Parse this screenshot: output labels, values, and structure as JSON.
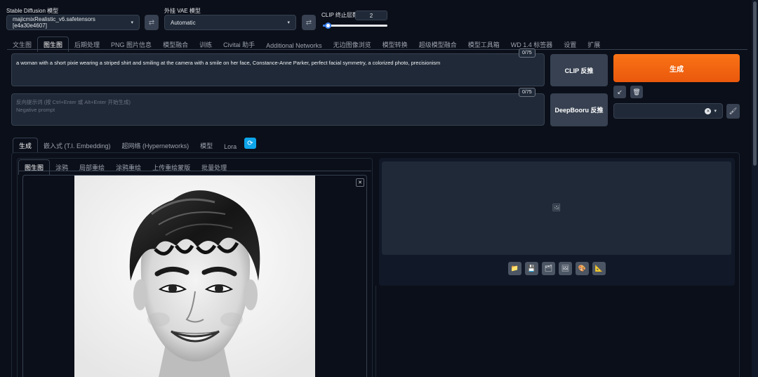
{
  "top": {
    "sd_model_label": "Stable Diffusion 模型",
    "sd_model_value": "majicmixRealistic_v6.safetensors [e4a30e4607]",
    "vae_label": "外挂 VAE 模型",
    "vae_value": "Automatic",
    "clip_label": "CLIP 终止层数",
    "clip_value": "2",
    "clip_fraction": 0.08
  },
  "tabs": [
    "文生图",
    "图生图",
    "后期处理",
    "PNG 图片信息",
    "模型融合",
    "训练",
    "Civitai 助手",
    "Additional Networks",
    "无边图像浏览",
    "模型转换",
    "超级模型融合",
    "模型工具箱",
    "WD 1.4 标签器",
    "设置",
    "扩展"
  ],
  "active_tab_index": 1,
  "prompt": {
    "positive": "a woman with a short pixie wearing a striped shirt and smiling at the camera with a smile on her face, Constance-Anne Parker, perfect facial symmetry, a colorized photo, precisionism",
    "positive_count": "0/75",
    "negative_placeholder_line1": "反向提示词 (按 Ctrl+Enter 或 Alt+Enter 开始生成)",
    "negative_placeholder_line2": "Negative prompt",
    "negative_count": "0/75"
  },
  "buttons": {
    "clip_interrogate": "CLIP 反推",
    "deepbooru_interrogate": "DeepBooru 反推",
    "generate": "生成"
  },
  "icons": {
    "swap": "⇄",
    "arrow": "↙",
    "trash": "🗑",
    "close": "✕",
    "caret": "▾",
    "brush": "🖌",
    "refresh": "⟳",
    "image": "🖼"
  },
  "style_select_value": "",
  "sub_tabs": [
    "生成",
    "嵌入式 (T.I. Embedding)",
    "超网络 (Hypernetworks)",
    "模型",
    "Lora"
  ],
  "img_tabs": [
    "图生图",
    "涂鸦",
    "局部重绘",
    "涂鸦重绘",
    "上传重绘蒙版",
    "批量处理"
  ],
  "output_tools": [
    "📁",
    "💾",
    "🗂",
    "🖼",
    "🎨",
    "📐"
  ],
  "colors": {
    "accent": "#ea580c",
    "background": "#0b0f19",
    "panel": "#1f2937",
    "blue": "#3b82f6"
  }
}
